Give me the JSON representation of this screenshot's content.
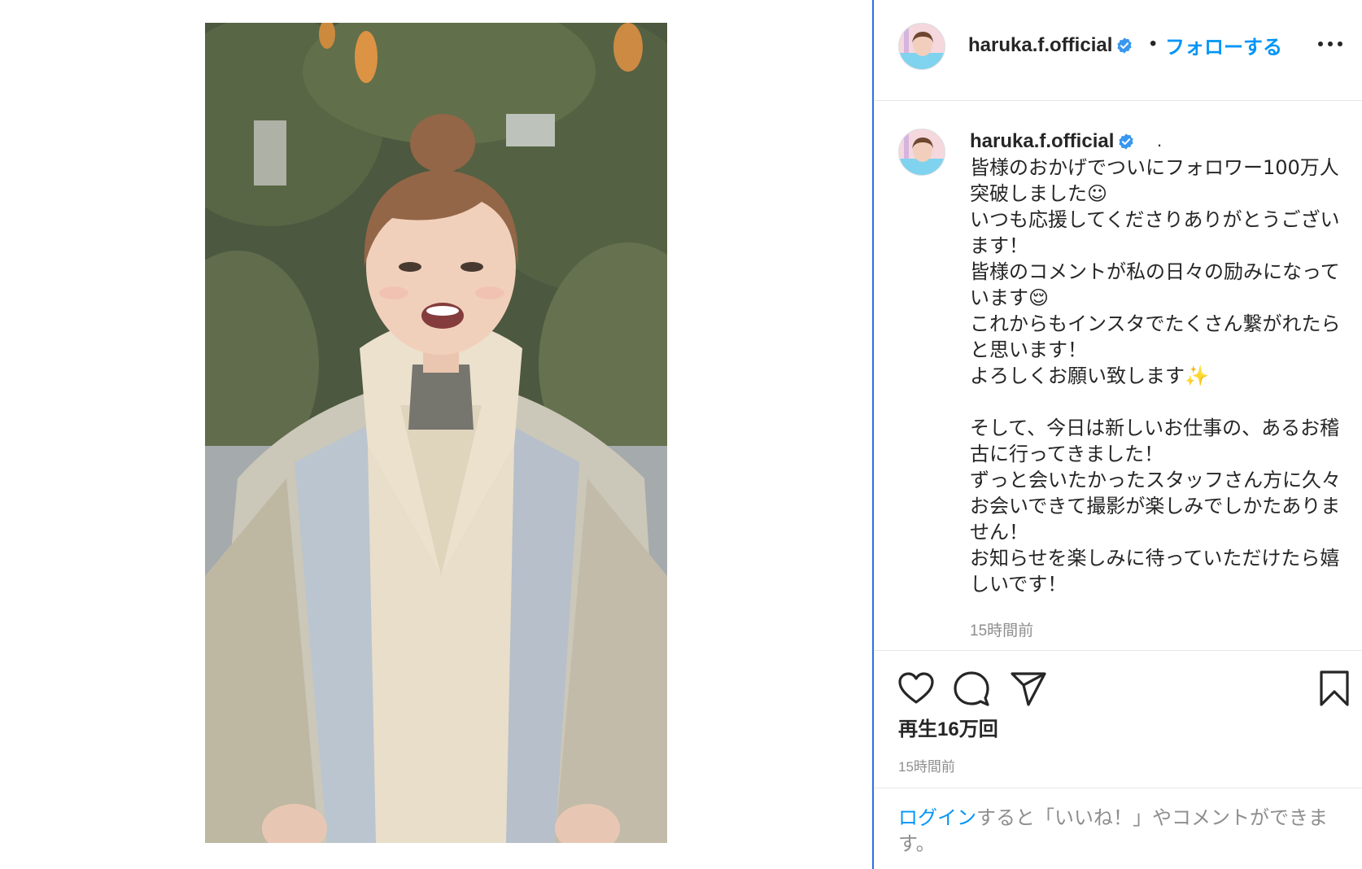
{
  "post": {
    "username": "haruka.f.official",
    "follow_label": "フォローする",
    "dot_separator": "•",
    "caption_dot": ".",
    "caption": "皆様のおかげでついにフォロワー100万人突破しました☺\nいつも応援してくださりありがとうございます！\n皆様のコメントが私の日々の励みになっています😌\nこれからもインスタでたくさん繋がれたらと思います！\nよろしくお願い致します✨\n\nそして、今日は新しいお仕事の、あるお稽古に行ってきました！\nずっと会いたかったスタッフさん方に久々お会いできて撮影が楽しみでしかたありません！\nお知らせを楽しみに待っていただけたら嬉しいです！",
    "caption_time": "15時間前",
    "plays": "再生16万回",
    "post_time": "15時間前"
  },
  "login": {
    "link_label": "ログイン",
    "rest_label": "すると「いいね！」やコメントができます。"
  },
  "icons": {
    "verified": "verified-badge-icon",
    "more": "more-options-icon",
    "like": "heart-icon",
    "comment": "comment-bubble-icon",
    "share": "paper-plane-icon",
    "save": "bookmark-icon"
  },
  "colors": {
    "accent": "#0095f6",
    "text": "#262626",
    "muted": "#8e8e8e",
    "verified": "#3897f0",
    "divider": "#2f6fe0"
  }
}
